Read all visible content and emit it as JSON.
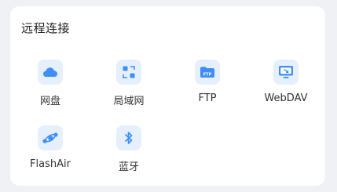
{
  "section": {
    "title": "远程连接"
  },
  "items": [
    {
      "label": "网盘",
      "icon": "cloud-icon"
    },
    {
      "label": "局域网",
      "icon": "lan-icon"
    },
    {
      "label": "FTP",
      "icon": "ftp-folder-icon"
    },
    {
      "label": "WebDAV",
      "icon": "webdav-monitor-icon"
    },
    {
      "label": "FlashAir",
      "icon": "flashair-icon"
    },
    {
      "label": "蓝牙",
      "icon": "bluetooth-icon"
    }
  ],
  "colors": {
    "accent": "#3f8ef5",
    "tile_bg": "#e6f0fd",
    "page_bg": "#f0f1f4"
  }
}
